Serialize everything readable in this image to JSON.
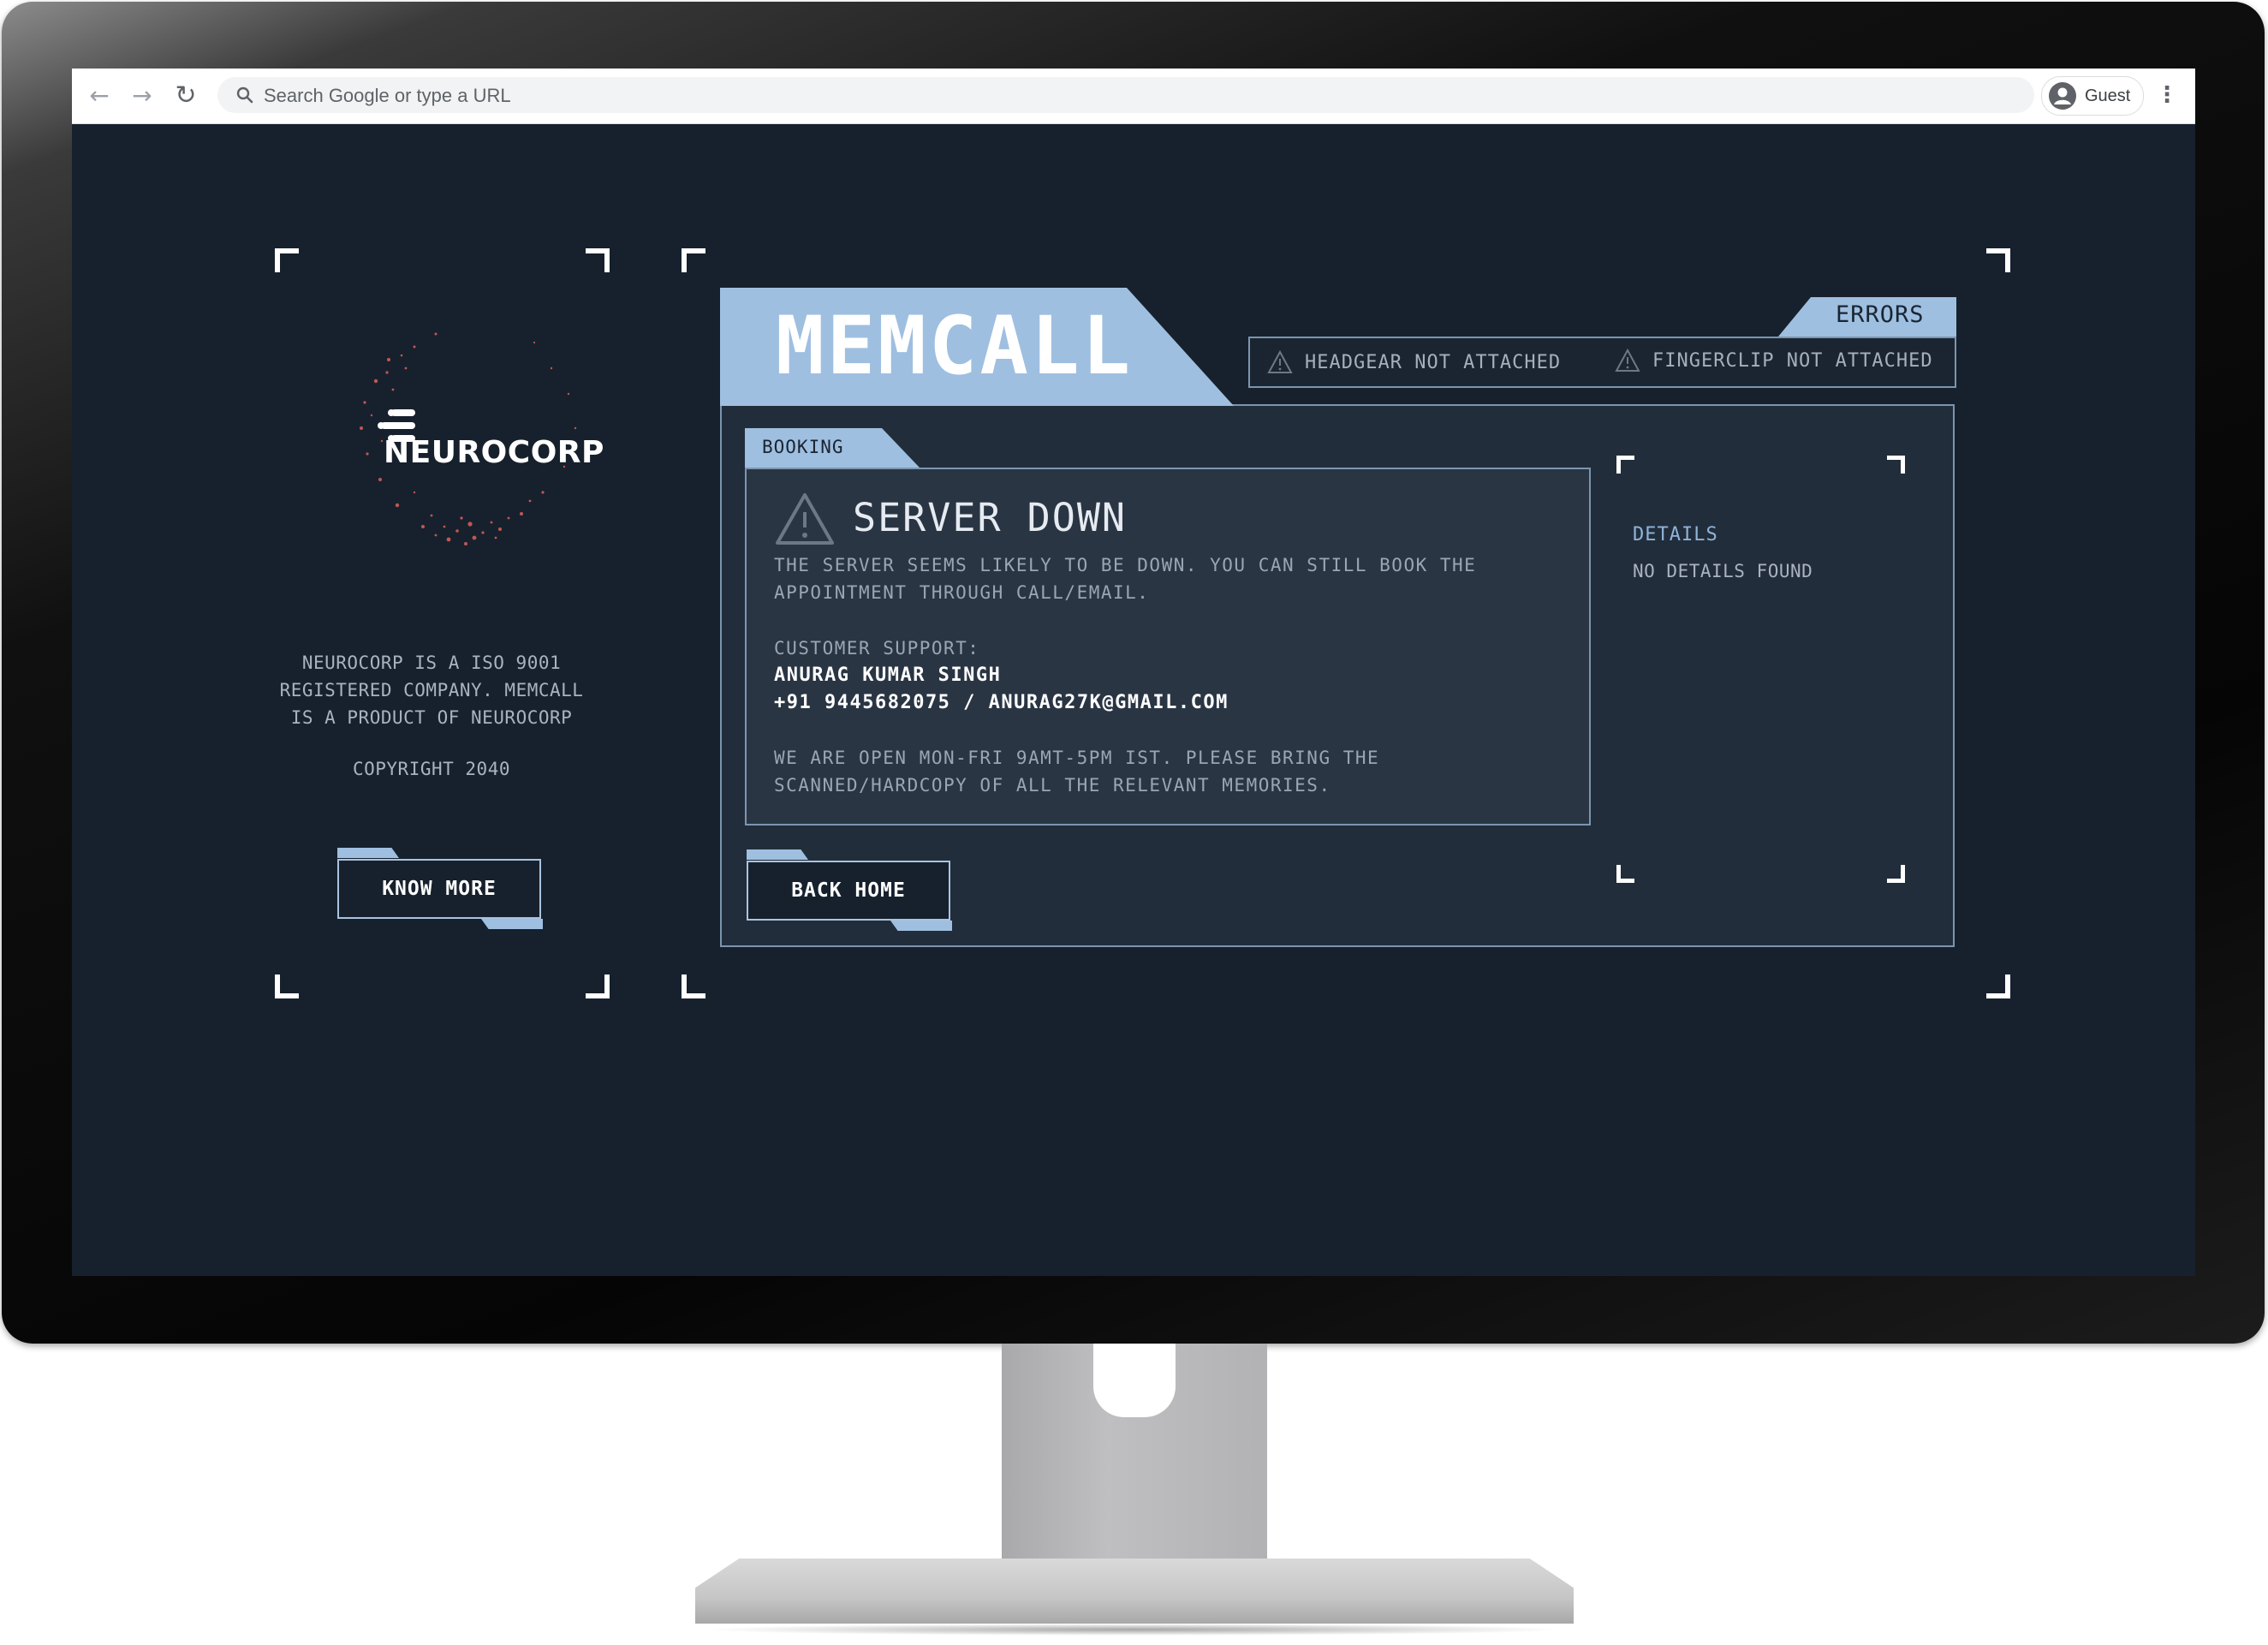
{
  "browser": {
    "omnibox_placeholder": "Search Google or type a URL",
    "profile_name": "Guest",
    "back_icon": "arrow-left-icon",
    "forward_icon": "arrow-right-icon",
    "reload_icon": "reload-icon",
    "menu_icon": "kebab-menu-icon"
  },
  "sidebar": {
    "brand": "NEUROCORP",
    "description_lines": [
      "NEUROCORP IS A ISO 9001",
      "REGISTERED COMPANY. MEMCALL",
      "IS A PRODUCT OF NEUROCORP"
    ],
    "copyright": "COPYRIGHT 2040",
    "know_more_label": "KNOW MORE"
  },
  "main": {
    "app_title": "MEMCALL",
    "errors": {
      "label": "ERRORS",
      "items": [
        "HEADGEAR NOT ATTACHED",
        "FINGERCLIP NOT ATTACHED"
      ]
    },
    "booking": {
      "tab_label": "BOOKING",
      "alert_title": "SERVER DOWN",
      "message_lines": [
        "THE SERVER SEEMS LIKELY TO BE DOWN. YOU CAN STILL BOOK THE",
        "APPOINTMENT THROUGH CALL/EMAIL."
      ],
      "support_label": "CUSTOMER SUPPORT:",
      "support_name": "ANURAG KUMAR SINGH",
      "support_contact": "+91 9445682075 / ANURAG27K@GMAIL.COM",
      "hours_lines": [
        "WE ARE OPEN MON-FRI 9AMT-5PM IST. PLEASE BRING THE",
        "SCANNED/HARDCOPY OF ALL THE RELEVANT MEMORIES."
      ]
    },
    "details": {
      "title": "DETAILS",
      "text": "NO DETAILS FOUND"
    },
    "back_home_label": "BACK HOME"
  },
  "colors": {
    "page_bg": "#17212d",
    "panel_bg": "#222d3b",
    "accent": "#9fbfe0",
    "border": "#7c95b0",
    "particles": "#e0605a"
  }
}
